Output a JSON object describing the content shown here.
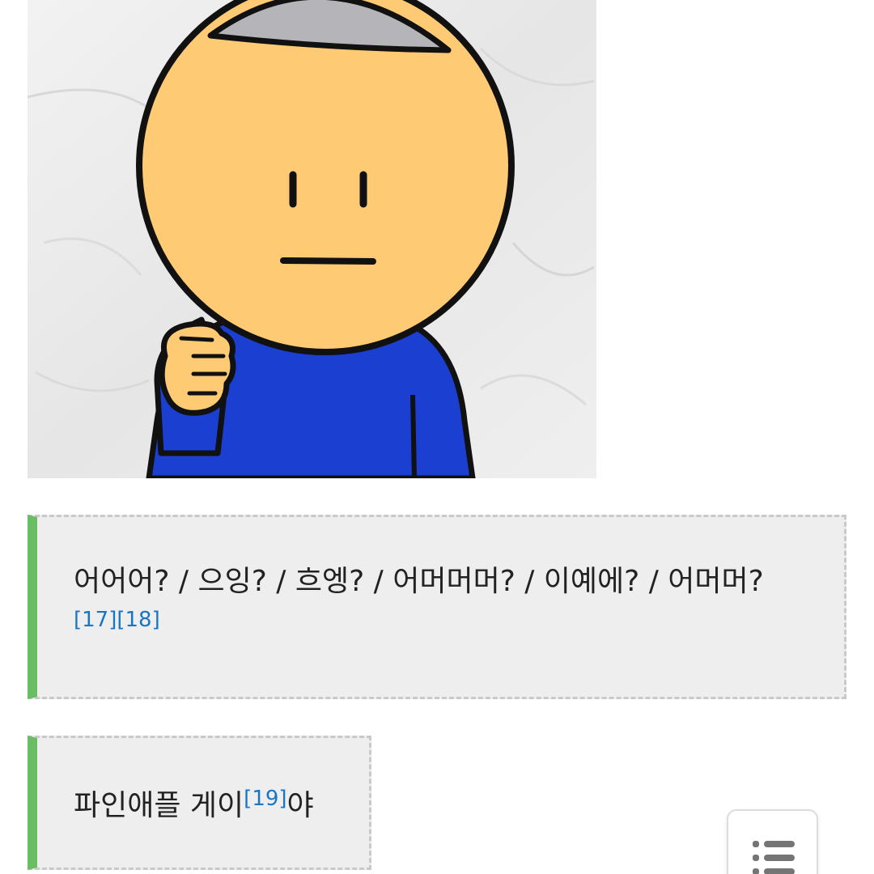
{
  "article": {
    "image": {
      "icon": "cartoon-character-illustration"
    },
    "quotes": [
      {
        "text": "어어어? / 으잉? / 흐엥? / 어머머머? / 이예에? / 어머머?",
        "footnotes": [
          "[17]",
          "[18]"
        ]
      },
      {
        "text_before": "파인애플 게이",
        "footnote": "[19]",
        "text_after": "야"
      }
    ]
  },
  "toc_button": {
    "icon": "list-icon"
  },
  "colors": {
    "quote_accent": "#69bd64",
    "quote_background": "#eeeeee",
    "footnote_link": "#1a75c2"
  }
}
